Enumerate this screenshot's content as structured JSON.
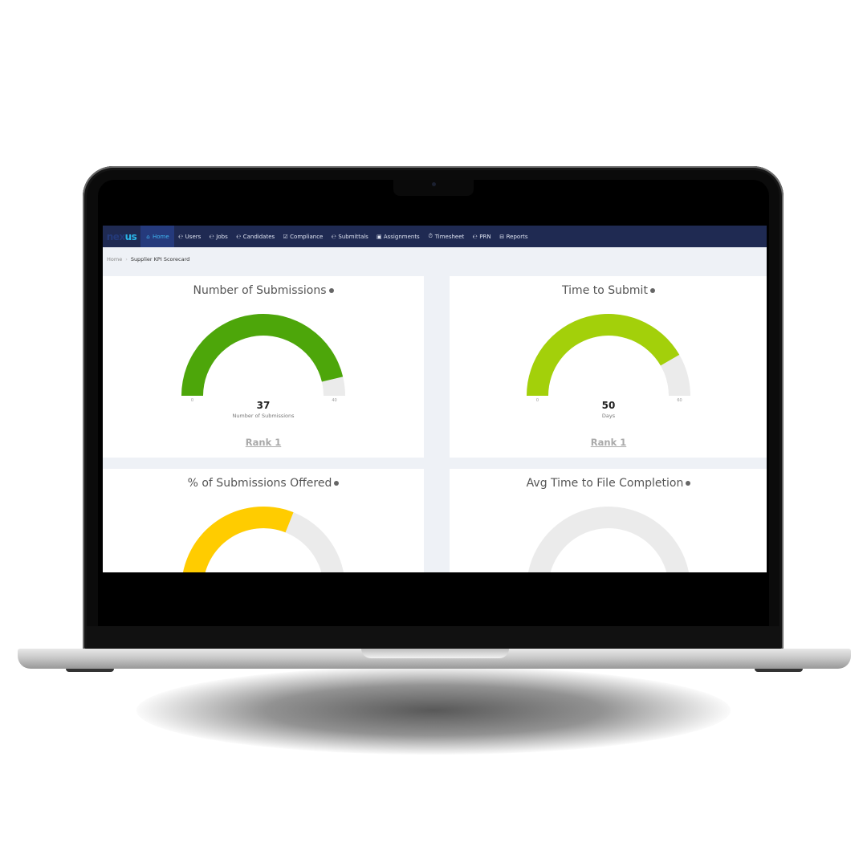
{
  "app": {
    "logo_part1": "nex",
    "logo_part2": "us"
  },
  "nav": {
    "items": [
      {
        "label": "Home",
        "icon": "home-icon",
        "glyph": "⌂",
        "active": true
      },
      {
        "label": "Users",
        "icon": "users-icon",
        "glyph": "℮",
        "active": false
      },
      {
        "label": "Jobs",
        "icon": "jobs-icon",
        "glyph": "℮",
        "active": false
      },
      {
        "label": "Candidates",
        "icon": "candidates-icon",
        "glyph": "℮",
        "active": false
      },
      {
        "label": "Compliance",
        "icon": "checkbox-icon",
        "glyph": "☑",
        "active": false
      },
      {
        "label": "Submittals",
        "icon": "submittals-icon",
        "glyph": "℮",
        "active": false
      },
      {
        "label": "Assignments",
        "icon": "clipboard-icon",
        "glyph": "▣",
        "active": false
      },
      {
        "label": "Timesheet",
        "icon": "stopwatch-icon",
        "glyph": "⏱",
        "active": false
      },
      {
        "label": "PRN",
        "icon": "prn-icon",
        "glyph": "℮",
        "active": false
      },
      {
        "label": "Reports",
        "icon": "reports-icon",
        "glyph": "⊟",
        "active": false
      }
    ]
  },
  "breadcrumb": {
    "home": "Home",
    "separator": "›",
    "current": "Supplier KPI Scorecard"
  },
  "colors": {
    "nav_bg": "#1f2a52",
    "green": "#4da60a",
    "lime": "#a3d00a",
    "yellow": "#ffcc00",
    "track": "#ebebeb"
  },
  "cards": [
    {
      "title": "Number of Submissions",
      "value": "37",
      "unit": "Number of Submissions",
      "min": "0",
      "max": "40",
      "fraction": 0.925,
      "color": "#4da60a",
      "rank": "Rank 1"
    },
    {
      "title": "Time to Submit",
      "value": "50",
      "unit": "Days",
      "min": "0",
      "max": "60",
      "fraction": 0.833,
      "color": "#a3d00a",
      "rank": "Rank 1"
    },
    {
      "title": "% of Submissions Offered",
      "fraction": 0.62,
      "color": "#ffcc00"
    },
    {
      "title": "Avg Time to File Completion",
      "fraction": 0,
      "color": "#ebebeb"
    }
  ]
}
